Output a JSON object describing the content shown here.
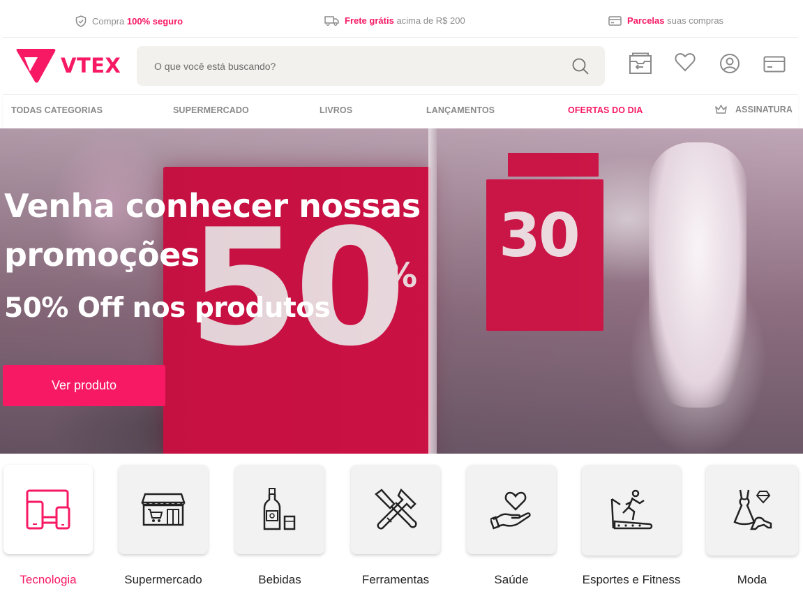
{
  "topbar": {
    "secure": {
      "prefix": "Compra",
      "highlight": "100% seguro",
      "suffix": ""
    },
    "shipping": {
      "prefix": "",
      "highlight": "Frete grátis",
      "suffix": "acima de R$ 200"
    },
    "installments": {
      "prefix": "",
      "highlight": "Parcelas",
      "suffix": "suas compras"
    }
  },
  "header": {
    "logo_text": "VTEX",
    "search_placeholder": "O que você está buscando?",
    "icons": [
      "order-history-icon",
      "heart-icon",
      "user-icon",
      "credit-card-icon"
    ]
  },
  "nav": {
    "items": [
      {
        "label": "TODAS CATEGORIAS"
      },
      {
        "label": "SUPERMERCADO"
      },
      {
        "label": "LIVROS"
      },
      {
        "label": "LANÇAMENTOS"
      },
      {
        "label": "OFERTAS DO DIA"
      },
      {
        "label": "ASSINATURA"
      }
    ]
  },
  "hero": {
    "title": "Venha conhecer nossas promoções",
    "subtitle": "50% Off nos produtos",
    "button_label": "Ver produto",
    "sign_left": "50",
    "sign_left_symbol": "%",
    "sign_right": "30"
  },
  "categories": [
    {
      "label": "Tecnologia",
      "icon": "devices-icon"
    },
    {
      "label": "Supermercado",
      "icon": "store-icon"
    },
    {
      "label": "Bebidas",
      "icon": "bottle-icon"
    },
    {
      "label": "Ferramentas",
      "icon": "tools-icon"
    },
    {
      "label": "Saúde",
      "icon": "heart-hand-icon"
    },
    {
      "label": "Esportes e Fitness",
      "icon": "treadmill-icon"
    },
    {
      "label": "Moda",
      "icon": "dress-icon"
    }
  ],
  "colors": {
    "brand": "#f71963",
    "text": "#3f3f40",
    "muted": "#8c8c8c"
  }
}
